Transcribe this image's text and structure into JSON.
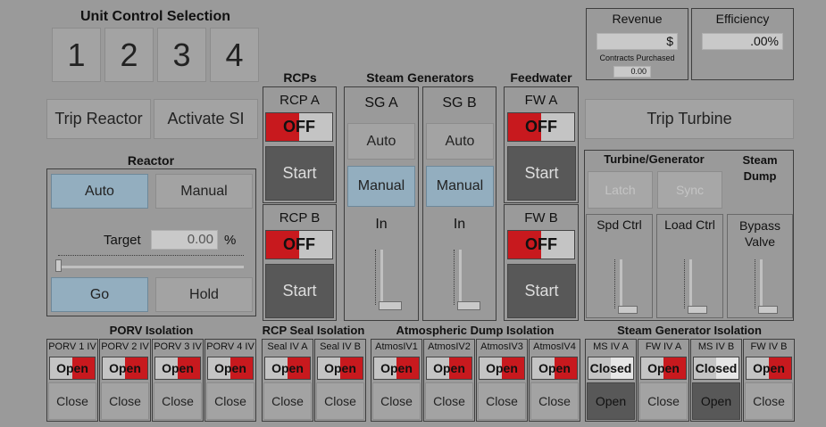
{
  "unit_control": {
    "title": "Unit Control Selection",
    "units": [
      "1",
      "2",
      "3",
      "4"
    ]
  },
  "revenue": {
    "title": "Revenue",
    "value": "$",
    "contracts_label": "Contracts Purchased",
    "contracts_value": "0.00"
  },
  "efficiency": {
    "title": "Efficiency",
    "value": ".00%"
  },
  "section_titles": {
    "rcps": "RCPs",
    "steam_generators": "Steam Generators",
    "feedwater": "Feedwater",
    "reactor": "Reactor",
    "turbine_generator": "Turbine/Generator",
    "steam_dump": "Steam Dump",
    "porv_isolation": "PORV Isolation",
    "rcp_seal_isolation": "RCP Seal Isolation",
    "atm_dump_isolation": "Atmospheric Dump Isolation",
    "sg_isolation": "Steam Generator Isolation"
  },
  "buttons": {
    "trip_reactor": "Trip Reactor",
    "activate_si": "Activate SI",
    "trip_turbine": "Trip Turbine"
  },
  "reactor": {
    "auto": "Auto",
    "manual": "Manual",
    "target_label": "Target",
    "target_value": "0.00",
    "target_unit": "%",
    "go": "Go",
    "hold": "Hold"
  },
  "rcp": {
    "a_label": "RCP A",
    "b_label": "RCP B",
    "a_state": "OFF",
    "b_state": "OFF",
    "start": "Start"
  },
  "sg": {
    "a_label": "SG A",
    "b_label": "SG B",
    "auto": "Auto",
    "manual": "Manual",
    "in_label": "In"
  },
  "fw": {
    "a_label": "FW A",
    "b_label": "FW B",
    "a_state": "OFF",
    "b_state": "OFF",
    "start": "Start"
  },
  "turbine": {
    "latch": "Latch",
    "sync": "Sync",
    "spd_ctrl": "Spd Ctrl",
    "load_ctrl": "Load Ctrl",
    "bypass": "Bypass Valve"
  },
  "porv": {
    "valves": [
      {
        "name": "PORV 1 IV",
        "state": "Open",
        "action": "Close"
      },
      {
        "name": "PORV 2 IV",
        "state": "Open",
        "action": "Close"
      },
      {
        "name": "PORV 3 IV",
        "state": "Open",
        "action": "Close"
      },
      {
        "name": "PORV 4 IV",
        "state": "Open",
        "action": "Close"
      }
    ]
  },
  "seal": {
    "valves": [
      {
        "name": "Seal IV A",
        "state": "Open",
        "action": "Close"
      },
      {
        "name": "Seal IV B",
        "state": "Open",
        "action": "Close"
      }
    ]
  },
  "atm": {
    "valves": [
      {
        "name": "AtmosIV1",
        "state": "Open",
        "action": "Close"
      },
      {
        "name": "AtmosIV2",
        "state": "Open",
        "action": "Close"
      },
      {
        "name": "AtmosIV3",
        "state": "Open",
        "action": "Close"
      },
      {
        "name": "AtmosIV4",
        "state": "Open",
        "action": "Close"
      }
    ]
  },
  "sgiso": {
    "valves": [
      {
        "name": "MS IV A",
        "state": "Closed",
        "action": "Open"
      },
      {
        "name": "FW IV A",
        "state": "Open",
        "action": "Close"
      },
      {
        "name": "MS IV B",
        "state": "Closed",
        "action": "Open"
      },
      {
        "name": "FW IV B",
        "state": "Open",
        "action": "Close"
      }
    ]
  },
  "colors": {
    "background": "#9a9a9a",
    "selected": "#93aebf",
    "off_red": "#c8191e",
    "dark_button": "#585858"
  }
}
